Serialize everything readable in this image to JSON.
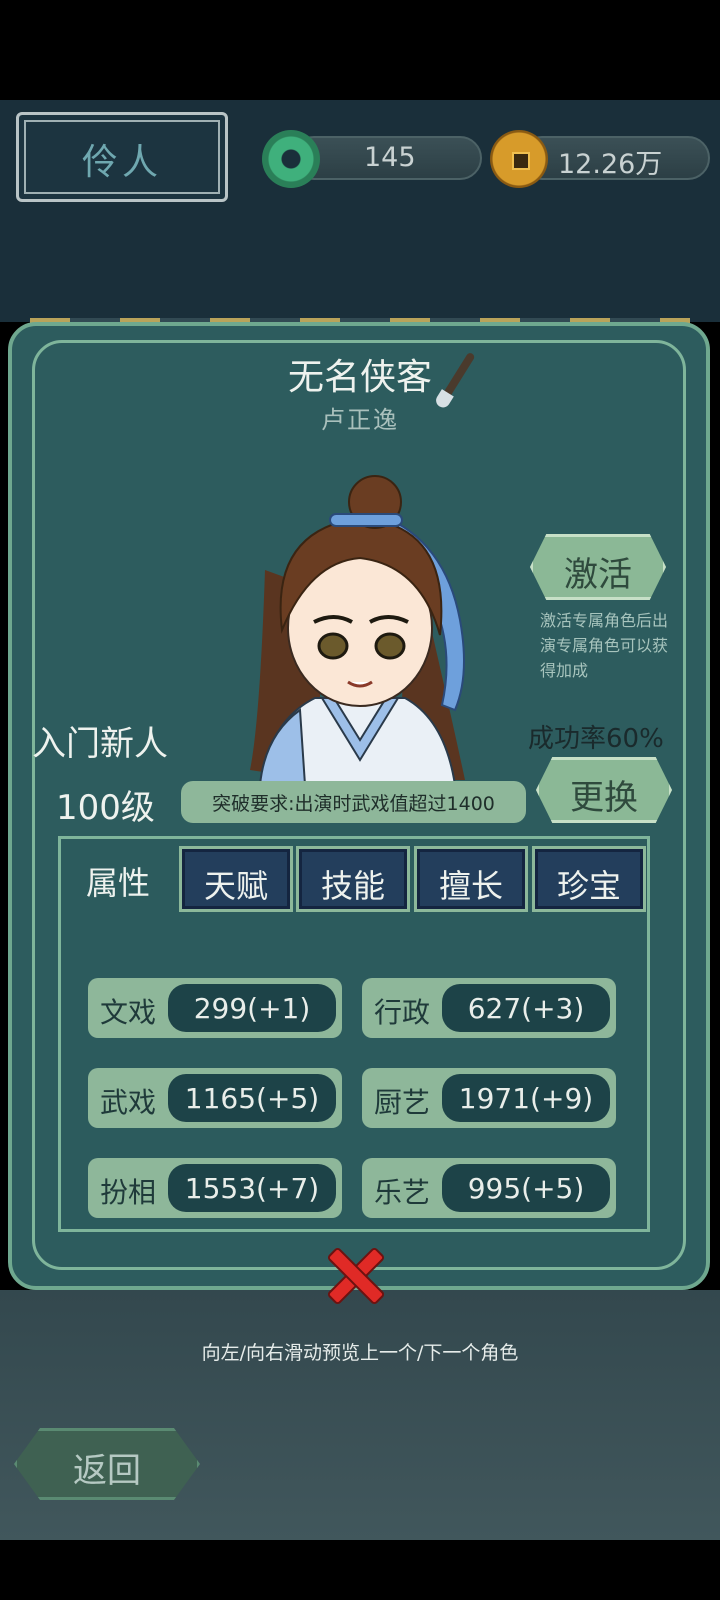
{
  "header": {
    "title": "伶人",
    "jade_currency": "145",
    "copper_currency": "12.26万"
  },
  "character": {
    "name": "无名侠客",
    "title": "卢正逸",
    "rank": "入门新人",
    "level": "100级",
    "breakthrough_requirement": "突破要求:出演时武戏值超过1400",
    "success_rate": "成功率60%"
  },
  "actions": {
    "activate_label": "激活",
    "activate_note": "激活专属角色后出演专属角色可以获得加成",
    "change_label": "更换"
  },
  "tabs": [
    {
      "label": "属性",
      "active": true
    },
    {
      "label": "天赋",
      "active": false
    },
    {
      "label": "技能",
      "active": false
    },
    {
      "label": "擅长",
      "active": false
    },
    {
      "label": "珍宝",
      "active": false
    }
  ],
  "stats": [
    {
      "label": "文戏",
      "value": "299(+1)"
    },
    {
      "label": "行政",
      "value": "627(+3)"
    },
    {
      "label": "武戏",
      "value": "1165(+5)"
    },
    {
      "label": "厨艺",
      "value": "1971(+9)"
    },
    {
      "label": "扮相",
      "value": "1553(+7)"
    },
    {
      "label": "乐艺",
      "value": "995(+5)"
    }
  ],
  "footer": {
    "swipe_hint": "向左/向右滑动预览上一个/下一个角色",
    "back_label": "返回"
  },
  "colors": {
    "panel": "#2d5c5e",
    "panel_border": "#6fa88f",
    "button_green": "#8bb896",
    "tab_blue": "#233e5c",
    "stat_pill": "#1d4348",
    "close_red": "#e02a26"
  }
}
